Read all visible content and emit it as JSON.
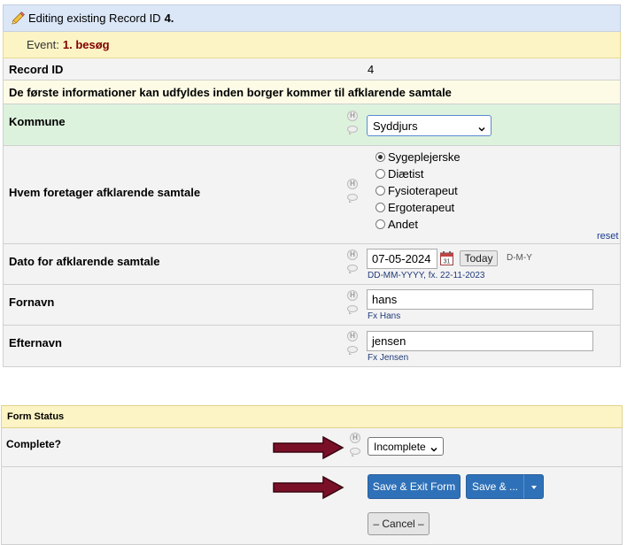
{
  "header": {
    "editing_prefix": "Editing existing Record ID",
    "record_id": "4.",
    "event_label": "Event:",
    "event_value": "1. besøg"
  },
  "fields": {
    "record_id": {
      "label": "Record ID",
      "value": "4"
    },
    "section_note": "De første informationer kan udfyldes inden borger kommer til afklarende samtale",
    "kommune": {
      "label": "Kommune",
      "value": "Syddjurs"
    },
    "hvem": {
      "label": "Hvem foretager afklarende samtale",
      "options": [
        "Sygeplejerske",
        "Diætist",
        "Fysioterapeut",
        "Ergoterapeut",
        "Andet"
      ],
      "selected": "Sygeplejerske",
      "reset_label": "reset"
    },
    "dato": {
      "label": "Dato for afklarende samtale",
      "value": "07-05-2024",
      "today_label": "Today",
      "format_label": "D-M-Y",
      "hint": "DD-MM-YYYY, fx. 22-11-2023"
    },
    "fornavn": {
      "label": "Fornavn",
      "value": "hans",
      "hint": "Fx Hans"
    },
    "efternavn": {
      "label": "Efternavn",
      "value": "jensen",
      "hint": "Fx Jensen"
    }
  },
  "form_status": {
    "header": "Form Status",
    "complete_label": "Complete?",
    "complete_value": "Incomplete",
    "save_exit_label": "Save & Exit Form",
    "save_more_label": "Save & ...",
    "cancel_label": "– Cancel –"
  },
  "colors": {
    "accent_blue": "#2f71b8",
    "arrow_red": "#7a1028",
    "event_text": "#800000",
    "kommune_row_bg": "#ddf2dd"
  }
}
